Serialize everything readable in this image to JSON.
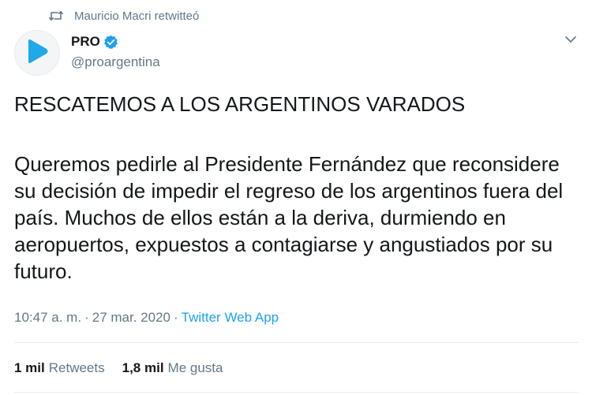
{
  "retweet": {
    "icon": "retweet-icon",
    "text": "Mauricio Macri retwitteó"
  },
  "author": {
    "avatar_icon": "pro-play-logo",
    "name": "PRO",
    "verified_icon": "verified-badge-icon",
    "handle": "@proargentina"
  },
  "menu": {
    "icon": "chevron-down-icon"
  },
  "tweet": {
    "title": "RESCATEMOS A LOS ARGENTINOS VARADOS",
    "body": "Queremos pedirle al Presidente Fernández que reconsidere su decisión de impedir el regreso de los argentinos fuera del país. Muchos de ellos están a la deriva, durmiendo en aeropuertos, expuestos a contagiarse y angustiados por su futuro."
  },
  "meta": {
    "time": "10:47 a. m.",
    "separator": "·",
    "date": "27 mar. 2020",
    "source": "Twitter Web App"
  },
  "stats": {
    "retweets_count": "1 mil",
    "retweets_label": "Retweets",
    "likes_count": "1,8 mil",
    "likes_label": "Me gusta"
  },
  "colors": {
    "accent": "#1da1f2",
    "muted": "#657786",
    "logo": "#1fa9e8"
  }
}
